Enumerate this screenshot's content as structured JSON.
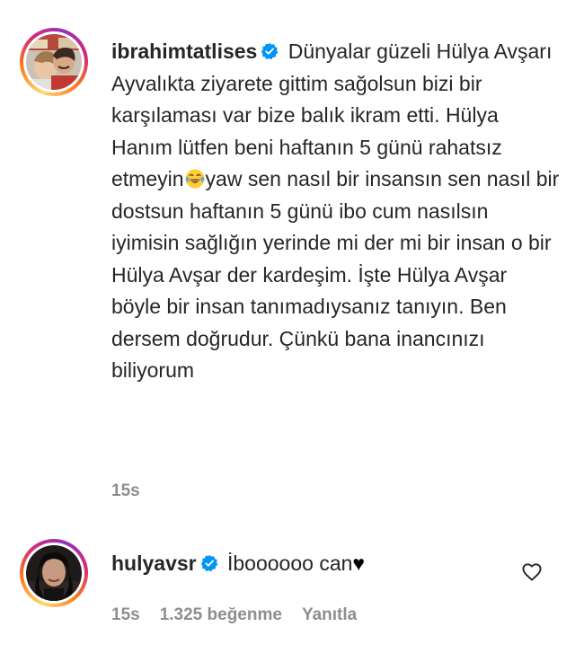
{
  "post": {
    "username": "ibrahimtatlises",
    "caption_part1": "Dünyalar güzeli Hülya Avşarı Ayvalıkta ziyarete gittim sağolsun bizi bir karşılaması var bize balık ikram etti. Hülya Hanım lütfen beni haftanın 5 günü rahatsız etmeyin",
    "emoji_icon": "face-with-tears-of-joy-icon",
    "caption_part2": "yaw sen nasıl bir insansın sen nasıl bir dostsun haftanın 5 günü ibo cum nasılsın iyimisin sağlığın yerinde mi der mi bir insan o bir Hülya Avşar der kardeşim. İşte Hülya Avşar böyle bir insan tanımadıysanız tanıyın. Ben dersem doğrudur. Çünkü bana inancınızı biliyorum",
    "time": "15s"
  },
  "reply": {
    "username": "hulyavsr",
    "text": "İboooooo can",
    "heart_glyph": "♥",
    "time": "15s",
    "likes": "1.325 beğenme",
    "reply_label": "Yanıtla"
  },
  "colors": {
    "verified_blue": "#0095f6",
    "meta_gray": "#8e8e8e",
    "text": "#262626"
  }
}
